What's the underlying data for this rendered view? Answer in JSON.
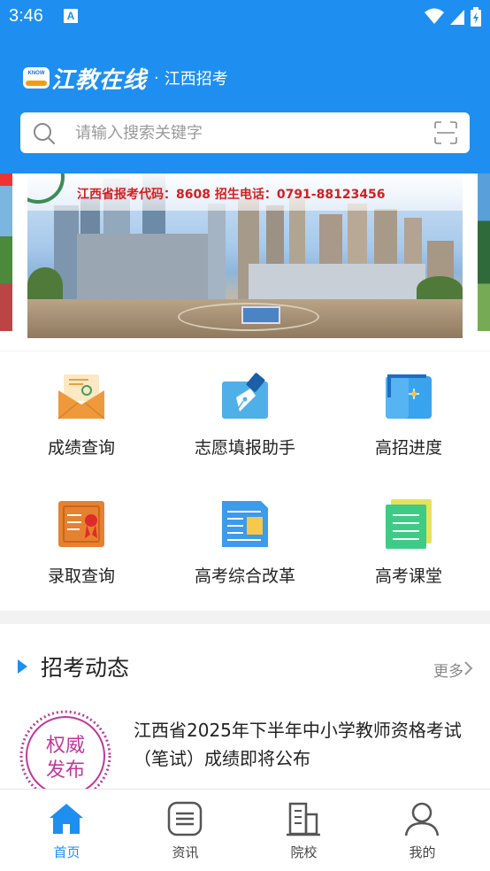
{
  "status_bar": {
    "time": "3:46",
    "notification_icon": "a-letter-icon"
  },
  "header": {
    "brand_name": "江教在线",
    "brand_separator": "·",
    "brand_region": "江西招考",
    "logo_text": "KNOW"
  },
  "search": {
    "placeholder": "请输入搜索关键字",
    "value": ""
  },
  "banner": {
    "text": "江西省报考代码：8608   招生电话：0791-88123456"
  },
  "grid": {
    "items": [
      {
        "label": "成绩查询",
        "icon": "score-envelope-icon"
      },
      {
        "label": "志愿填报助手",
        "icon": "pen-nib-icon"
      },
      {
        "label": "高招进度",
        "icon": "progress-board-icon"
      },
      {
        "label": "录取查询",
        "icon": "certificate-icon"
      },
      {
        "label": "高考综合改革",
        "icon": "document-icon"
      },
      {
        "label": "高考课堂",
        "icon": "notebook-icon"
      }
    ]
  },
  "news": {
    "section_title": "招考动态",
    "more_label": "更多",
    "badge_line1": "权威",
    "badge_line2": "发布",
    "item_title": "江西省2025年下半年中小学教师资格考试（笔试）成绩即将公布"
  },
  "bottom_nav": {
    "items": [
      {
        "label": "首页",
        "icon": "home-icon",
        "active": true
      },
      {
        "label": "资讯",
        "icon": "news-list-icon",
        "active": false
      },
      {
        "label": "院校",
        "icon": "buildings-icon",
        "active": false
      },
      {
        "label": "我的",
        "icon": "person-icon",
        "active": false
      }
    ]
  },
  "colors": {
    "primary": "#1e8ff0",
    "badge": "#c0399a"
  }
}
